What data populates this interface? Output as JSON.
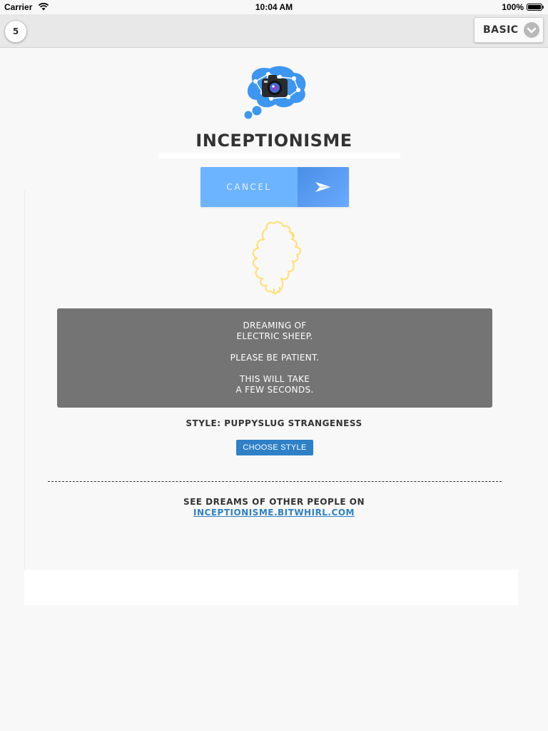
{
  "status_bar": {
    "carrier": "Carrier",
    "time": "10:04 AM",
    "battery": "100%"
  },
  "toolbar": {
    "counter": "5",
    "mode_label": "BASIC"
  },
  "header": {
    "app_title": "INCEPTIONISME"
  },
  "action": {
    "cancel_label": "CANCEL"
  },
  "message": {
    "line1": "DREAMING OF",
    "line2": "ELECTRIC SHEEP.",
    "line3": "PLEASE BE PATIENT.",
    "line4": "THIS WILL TAKE",
    "line5": "A FEW SECONDS."
  },
  "style": {
    "label": "STYLE: PUPPYSLUG STRANGENESS",
    "button_label": "CHOOSE STYLE"
  },
  "footer": {
    "text": "SEE DREAMS OF OTHER PEOPLE ON",
    "link": "INCEPTIONISME.BITWHIRL.COM"
  },
  "colors": {
    "accent_blue": "#2f80c6",
    "cancel_blue": "#6cb4ff",
    "message_bg": "#747474",
    "sheep_outline": "#ffe07a"
  },
  "icons": {
    "logo": "brain-camera-logo",
    "send": "paper-plane-icon",
    "sheep": "sheep-outline-icon",
    "chevron": "chevron-down-icon",
    "wifi": "wifi-icon",
    "battery": "battery-icon"
  }
}
